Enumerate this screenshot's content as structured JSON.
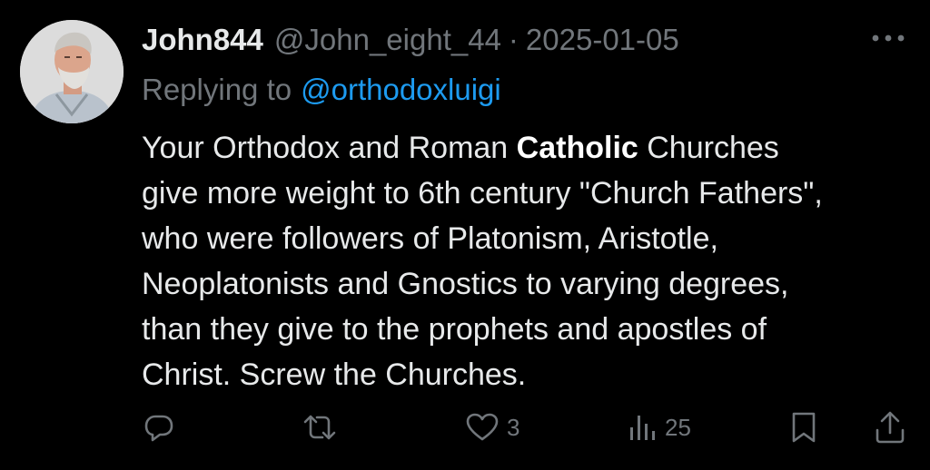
{
  "tweet": {
    "display_name": "John844",
    "handle": "@John_eight_44",
    "separator": "·",
    "date": "2025-01-05",
    "replying_label": "Replying to",
    "replying_handle": "@orthodoxluigi",
    "body": {
      "line1_a": "Your Orthodox and Roman ",
      "line1_b": "Catholic",
      "line1_c": " Churches",
      "line2": "give more weight to 6th century \"Church Fathers\",",
      "line3": "who were followers of Platonism, Aristotle,",
      "line4": "Neoplatonists and Gnostics to varying degrees,",
      "line5": "than they give to the prophets and apostles of",
      "line6": "Christ. Screw the Churches."
    },
    "actions": {
      "reply": {
        "icon": "reply-icon"
      },
      "retweet": {
        "icon": "retweet-icon"
      },
      "like": {
        "icon": "heart-icon",
        "count": "3"
      },
      "views": {
        "icon": "views-icon",
        "count": "25"
      },
      "bookmark": {
        "icon": "bookmark-icon"
      },
      "share": {
        "icon": "share-icon"
      }
    }
  },
  "colors": {
    "background": "#000000",
    "text_primary": "#e7e9ea",
    "text_secondary": "#71767b",
    "link": "#1d9bf0"
  }
}
